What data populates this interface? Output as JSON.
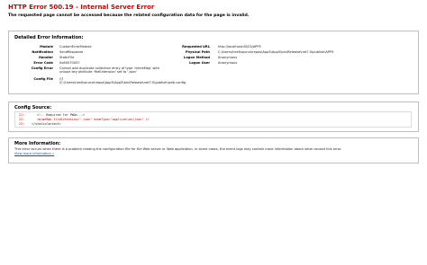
{
  "header": {
    "title": "HTTP Error 500.19 - Internal Server Error",
    "subtitle": "The requested page cannot be accessed because the related configuration data for the page is invalid."
  },
  "details": {
    "heading": "Detailed Error Information:",
    "left": [
      {
        "label": "Module",
        "value": "CustomErrorModule"
      },
      {
        "label": "Notification",
        "value": "SendResponse"
      },
      {
        "label": "Handler",
        "value": "StaticFile"
      },
      {
        "label": "Error Code",
        "value": "0x80070057"
      },
      {
        "label": "Config Error",
        "value": "Cannot add duplicate collection entry of type 'mimeMap' with unique key attribute 'fileExtension' set to '.json'"
      },
      {
        "label": "Config File",
        "value": "\\\\?\\C:\\Users\\hesf\\source\\repos\\App5\\App5\\bin\\Release\\net7.0\\publish\\web.config"
      }
    ],
    "right": [
      {
        "label": "Requested URL",
        "value": "http://localhost:8023/APP5"
      },
      {
        "label": "Physical Path",
        "value": "C:\\Users\\hesf\\source\\repos\\App5\\App5\\bin\\Release\\net7.0\\publish\\APP5"
      },
      {
        "label": "Logon Method",
        "value": "Anonymous"
      },
      {
        "label": "Logon User",
        "value": "Anonymous"
      }
    ]
  },
  "source": {
    "heading": "Config Source:",
    "lines": [
      {
        "no": "21:",
        "text": "<!-- Required for PWAs -->",
        "highlight": false
      },
      {
        "no": "22:",
        "text": "<mimeMap fileExtension=\".json\" mimeType=\"application/json\" />",
        "highlight": true
      },
      {
        "no": "23:",
        "text": "</staticContent>",
        "highlight": false
      }
    ]
  },
  "more": {
    "heading": "More Information:",
    "text": "This error occurs when there is a problem reading the configuration file for the Web server or Web application. In some cases, the event logs may contain more information about what caused this error.",
    "link": "View more information »"
  }
}
